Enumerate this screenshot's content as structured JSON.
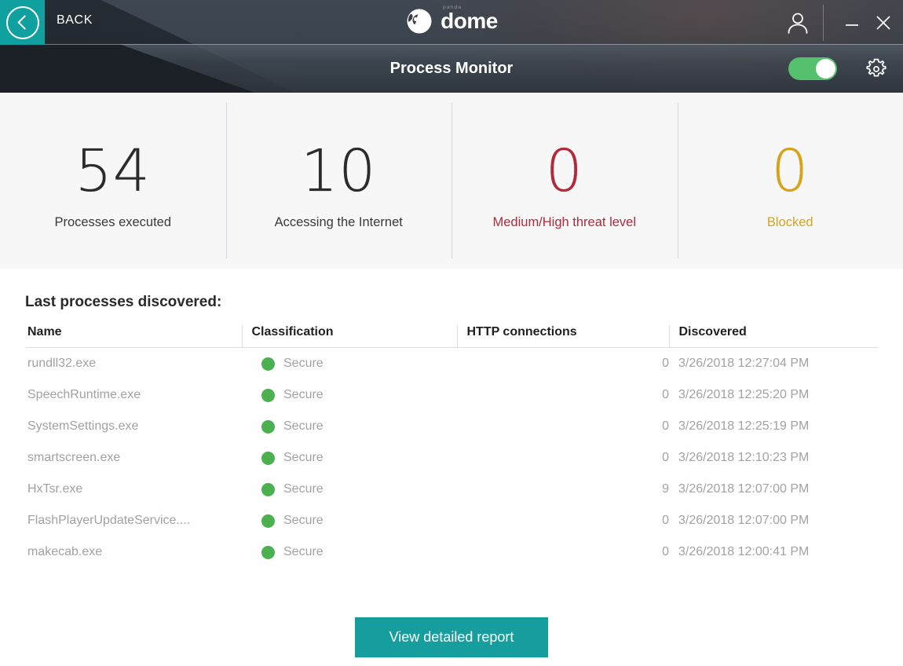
{
  "window": {
    "back_label": "BACK",
    "brand_super": "panda",
    "brand_name": "dome",
    "minimize_icon": "minimize-icon",
    "close_icon": "close-icon",
    "user_icon": "user-account-icon",
    "back_icon": "chevron-left-icon"
  },
  "page": {
    "title": "Process Monitor",
    "toggle_state": "on",
    "settings_icon": "gear-icon"
  },
  "stats": [
    {
      "value": "54",
      "label": "Processes executed",
      "tone": "neutral",
      "color": "#2b2b2b"
    },
    {
      "value": "10",
      "label": "Accessing the Internet",
      "tone": "neutral",
      "color": "#2b2b2b"
    },
    {
      "value": "0",
      "label": "Medium/High threat level",
      "tone": "danger",
      "color": "#b3293b"
    },
    {
      "value": "0",
      "label": "Blocked",
      "tone": "warn",
      "color": "#d9a21c"
    }
  ],
  "table": {
    "section_title": "Last processes discovered:",
    "columns": [
      "Name",
      "Classification",
      "HTTP connections",
      "Discovered"
    ],
    "rows": [
      {
        "name": "rundll32.exe",
        "classification": "Secure",
        "status_color": "#4cb050",
        "http": "0",
        "discovered": "3/26/2018 12:27:04 PM"
      },
      {
        "name": "SpeechRuntime.exe",
        "classification": "Secure",
        "status_color": "#4cb050",
        "http": "0",
        "discovered": "3/26/2018 12:25:20 PM"
      },
      {
        "name": "SystemSettings.exe",
        "classification": "Secure",
        "status_color": "#4cb050",
        "http": "0",
        "discovered": "3/26/2018 12:25:19 PM"
      },
      {
        "name": "smartscreen.exe",
        "classification": "Secure",
        "status_color": "#4cb050",
        "http": "0",
        "discovered": "3/26/2018 12:10:23 PM"
      },
      {
        "name": "HxTsr.exe",
        "classification": "Secure",
        "status_color": "#4cb050",
        "http": "9",
        "discovered": "3/26/2018 12:07:00 PM"
      },
      {
        "name": "FlashPlayerUpdateService....",
        "classification": "Secure",
        "status_color": "#4cb050",
        "http": "0",
        "discovered": "3/26/2018 12:07:00 PM"
      },
      {
        "name": "makecab.exe",
        "classification": "Secure",
        "status_color": "#4cb050",
        "http": "0",
        "discovered": "3/26/2018 12:00:41 PM"
      }
    ]
  },
  "footer": {
    "report_button": "View detailed report"
  },
  "theme": {
    "accent": "#169e9e",
    "back_square": "#10a0a0",
    "toggle_on": "#55c16e",
    "danger": "#b3293b",
    "warn": "#d9a21c",
    "secure": "#4cb050"
  }
}
